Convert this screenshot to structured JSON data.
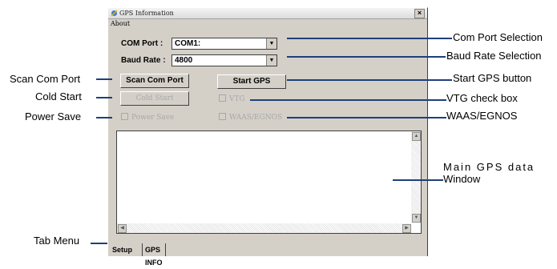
{
  "window": {
    "title": "GPS Information",
    "close_label": "×",
    "menu": [
      "About"
    ]
  },
  "form": {
    "com_port_label": "COM Port :",
    "com_port_value": "COM1:",
    "baud_rate_label": "Baud Rate :",
    "baud_rate_value": "4800",
    "scan_button": "Scan Com Port",
    "start_button": "Start GPS",
    "cold_start_button": "Cold Start",
    "vtg_checkbox": "VTG",
    "power_save_checkbox": "Power Save",
    "waas_checkbox": "WAAS/EGNOS"
  },
  "tabs": [
    "Setup",
    "GPS INFO"
  ],
  "callouts": {
    "com_port_selection": "Com Port Selection",
    "baud_rate_selection": "Baud Rate Selection",
    "start_gps_button": "Start GPS button",
    "vtg_check_box": "VTG check box",
    "waas_egnos": "WAAS/EGNOS",
    "main_gps_data_line1": "Main  GPS  data",
    "main_gps_data_line2": "Window",
    "scan_com_port": "Scan Com Port",
    "cold_start": "Cold Start",
    "power_save": "Power Save",
    "tab_menu": "Tab Menu"
  },
  "colors": {
    "callout_line": "#1f3f7a",
    "window_face": "#d4d0c8"
  }
}
